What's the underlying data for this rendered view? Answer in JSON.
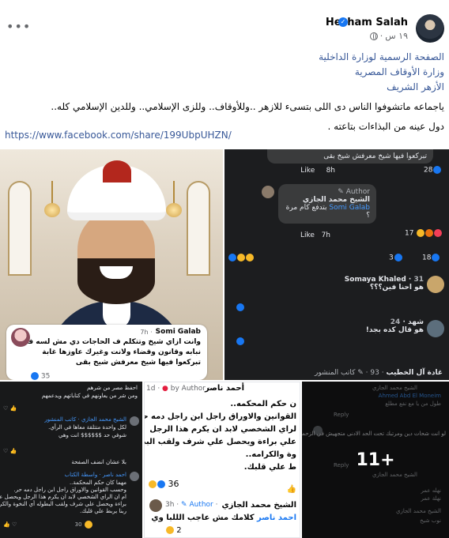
{
  "header": {
    "author": "Hesham Salah",
    "verified_icon": "verified-badge-icon",
    "time": "١٩ س",
    "audience_icon": "globe-icon",
    "more_icon": "more-options-icon"
  },
  "post": {
    "tags": [
      "الصفحة الرسمية لوزارة الداخلية",
      "وزارة الأوقاف المصرية",
      "الأزهر الشريف"
    ],
    "body": [
      "ياجماعه ماتشوفوا الناس دى اللى بتسىء للازهر ..وللأوقاف.. وللزى الإسلامي.. وللدين الإسلامي كله..",
      "دول عينه من البذاءات بتاعته ."
    ],
    "link": "https://www.facebook.com/share/199UbpUHZN/"
  },
  "tile1": {
    "commenter": "Somi Galab",
    "time": "· 7h",
    "text": [
      "وانت ازاي شيخ وتتكلم ف الحاجات دي مش لسه في",
      "نبابه وقانون وقضاء ولانت وغيرك عاوزها غابة",
      "تبركعوا فيها شيخ معرفش شيخ بقى"
    ],
    "react_count": "35"
  },
  "tile2": {
    "top_text": "تبركعوا فيها شيخ معرفش شيخ بقى",
    "age1": "8h",
    "like": "Like",
    "count1": "28",
    "author_label": "Author",
    "reply_name": "الشيخ محمد الجازي",
    "reply_tag": "Somi Galab",
    "reply_text": "بتدفع كام مرة ؟",
    "age2": "7h",
    "count2": "17",
    "counts_row": [
      "3",
      "18"
    ],
    "c2_name": "Somaya Khaled",
    "c2_time": "31",
    "c2_text": "هو احنا فين؟؟؟",
    "c3_name": "شهد",
    "c3_time": "24",
    "c3_text": "هو قال كده بجد!",
    "c4_name": "غادة آل الخطيب",
    "c4_time": "93",
    "c4_badge": "كاتب المنشور"
  },
  "tile3": {
    "lines": [
      "احفظ مصر من شرهم",
      "ومن شر من يعاونهم في كتاباتهم ويدعمهم",
      "الشيخ محمد الجازي · كاتب المنشور",
      "لكل واحدة متتلقة معاها في الرأي.",
      "شوفي حد $$$$$$ انت وهي",
      "بلا عشان انضف الصفحة",
      "احمد ناصر · واسطة الكتاب",
      "مهما كان حكم المحكمة..",
      "وحسب القوانين والاوراق راجل ابن راجل دمه حر.",
      "ام ان الراي الشخصي لابد ان يكرم هذا الرجل ويحصل علي",
      "براءة ويحصل علي شرف ولقب البطوله أي النخوة والكرامه.",
      "ربنا يربط علي قلبك."
    ],
    "count": "30"
  },
  "tile4": {
    "name1": "أحمد ناصر",
    "by_author": "by Author",
    "age1": "1d",
    "lines": [
      "ن حكم المحكمه..",
      "القوانين والاوراق راجل ابن راجل دمه حر.",
      "لراي الشخصي لابد ان يكرم هذا الرجل",
      "علي براءة ويحصل علي شرف ولقب البطوله",
      "وة والكرامه..",
      "ط علي قلبك."
    ],
    "count1": "36",
    "name2": "الشيخ محمد الجازي",
    "author_label": "Author",
    "age2": "3h",
    "reply_tag": "احمد ناصر",
    "reply_text": "كلامك مش عاجب الللبا وي",
    "count2": "2"
  },
  "tile5": {
    "more": "11+",
    "lines": [
      "الشيخ محمد الجازي",
      "Ahmed Abd El Moneim",
      "طول من يا مع نفع مطلع",
      "Reply",
      "Reply",
      "لو انت شحات دين ومرتبك تحت الحد الادنى متجهيش في الزحمه دي",
      "نهله عمر",
      "الشيخ محمد الجازي",
      "نهلة عمر",
      "الشيخ محمد الجازي",
      "نوب شيخ"
    ]
  },
  "colors": {
    "link": "#385898",
    "fb_blue": "#1877f2",
    "dark_bg": "#1c1d1f"
  }
}
